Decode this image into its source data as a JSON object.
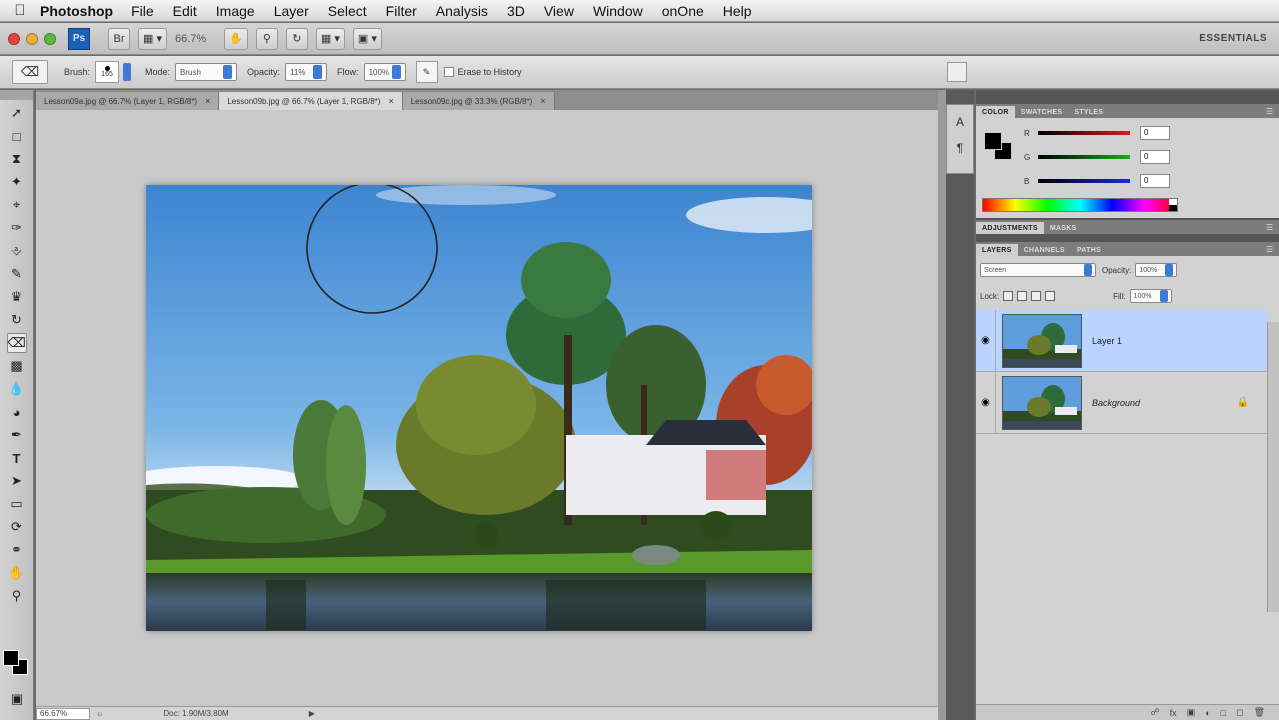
{
  "menubar": {
    "app_name": "Photoshop",
    "items": [
      "File",
      "Edit",
      "Image",
      "Layer",
      "Select",
      "Filter",
      "Analysis",
      "3D",
      "View",
      "Window",
      "onOne",
      "Help"
    ]
  },
  "appbar": {
    "logo": "Ps",
    "zoom": "66.7%",
    "workspace": "ESSENTIALS"
  },
  "options": {
    "brush_label": "Brush:",
    "brush_size": "165",
    "mode_label": "Mode:",
    "mode_value": "Brush",
    "opacity_label": "Opacity:",
    "opacity_value": "11%",
    "flow_label": "Flow:",
    "flow_value": "100%",
    "erase_history_label": "Erase to History"
  },
  "tabs": [
    {
      "label": "Lesson09a.jpg @ 66.7% (Layer 1, RGB/8*)"
    },
    {
      "label": "Lesson09b.jpg @ 66.7% (Layer 1, RGB/8*)"
    },
    {
      "label": "Lesson09c.jpg @ 33.3% (RGB/8*)"
    }
  ],
  "status": {
    "zoom": "66.67%",
    "doc": "Doc: 1.90M/3.80M"
  },
  "panels": {
    "color_tabs": [
      "COLOR",
      "SWATCHES",
      "STYLES"
    ],
    "color_channels": [
      {
        "label": "R",
        "value": "0",
        "color": "#d31e1e"
      },
      {
        "label": "G",
        "value": "0",
        "color": "#1ea81e"
      },
      {
        "label": "B",
        "value": "0",
        "color": "#1e2bd3"
      }
    ],
    "adjust_tabs": [
      "ADJUSTMENTS",
      "MASKS"
    ],
    "layer_tabs": [
      "LAYERS",
      "CHANNELS",
      "PATHS"
    ],
    "blend_mode": "Screen",
    "opacity_label": "Opacity:",
    "opacity_value": "100%",
    "lock_label": "Lock:",
    "fill_label": "Fill:",
    "fill_value": "100%",
    "layers": [
      {
        "name": "Layer 1",
        "selected": true
      },
      {
        "name": "Background",
        "selected": false
      }
    ]
  },
  "colors": {
    "accent_blue": "#3d7ad8",
    "layer_selected": "#b8d4ff",
    "sky": "#5e9edc"
  }
}
